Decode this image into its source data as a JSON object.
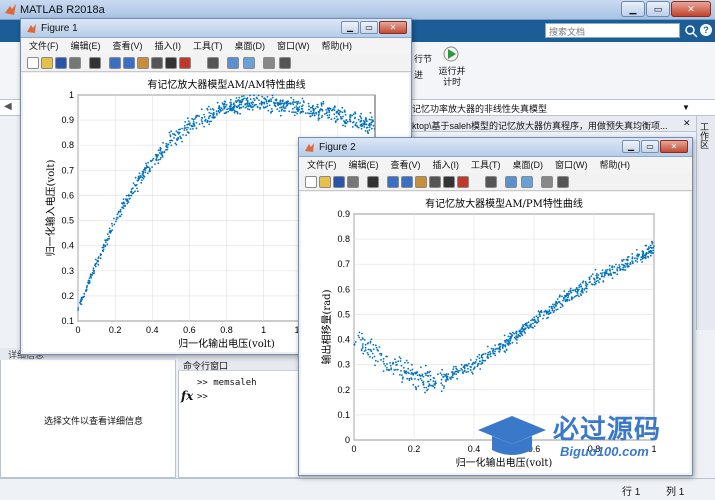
{
  "matlab": {
    "title": "MATLAB R2018a",
    "search_placeholder": "搜索文档",
    "help": "?",
    "ribbon_text1": "行节",
    "ribbon_text2": "进",
    "run_advance_label": "运行并计时",
    "path_text": "记忆功率放大器的非线性失真模型",
    "doc_text": "ktop\\基于saleh模型的记忆放大器仿真程序，用做预失真均衡项...",
    "workspace_label": "工作区",
    "details_title": "详细信息",
    "details_message": "选择文件以查看详细信息",
    "command_window_title": "命令行窗口",
    "command_history": ">> memsaleh",
    "command_prompt": ">>",
    "fx": "fx",
    "status_row": "行 1",
    "status_col": "列 1"
  },
  "menus": [
    "文件(F)",
    "编辑(E)",
    "查看(V)",
    "插入(I)",
    "工具(T)",
    "桌面(D)",
    "窗口(W)",
    "帮助(H)"
  ],
  "figure1": {
    "name": "Figure 1",
    "chart_title": "有记忆放大器模型AM/AM特性曲线",
    "xlabel": "归一化输出电压(volt)",
    "ylabel": "归一化输入电压(volt)"
  },
  "figure2": {
    "name": "Figure 2",
    "chart_title": "有记忆放大器模型AM/PM特性曲线",
    "xlabel": "归一化输出电压(volt)",
    "ylabel": "输出相移量(rad)"
  },
  "watermark": {
    "main": "必过源码",
    "url": "Biguo100.com"
  },
  "chart_data": [
    {
      "type": "scatter",
      "title": "有记忆放大器模型AM/AM特性曲线",
      "xlabel": "归一化输出电压(volt)",
      "ylabel": "归一化输入电压(volt)",
      "xlim": [
        0,
        1.6
      ],
      "ylim": [
        0.1,
        1.0
      ],
      "xticks": [
        "0",
        "0.2",
        "0.4",
        "0.6",
        "0.8",
        "1",
        "1.2",
        "1.4"
      ],
      "yticks": [
        "0.1",
        "0.2",
        "0.3",
        "0.4",
        "0.5",
        "0.6",
        "0.7",
        "0.8",
        "0.9",
        "1"
      ],
      "grid": true,
      "color": "#0072bd",
      "trend": {
        "x": [
          0.0,
          0.1,
          0.2,
          0.3,
          0.4,
          0.5,
          0.6,
          0.7,
          0.8,
          0.9,
          1.0,
          1.1,
          1.2,
          1.3,
          1.4,
          1.5,
          1.6
        ],
        "y": [
          0.15,
          0.33,
          0.5,
          0.63,
          0.73,
          0.82,
          0.88,
          0.92,
          0.95,
          0.965,
          0.97,
          0.96,
          0.95,
          0.94,
          0.92,
          0.9,
          0.88
        ]
      }
    },
    {
      "type": "scatter",
      "title": "有记忆放大器模型AM/PM特性曲线",
      "xlabel": "归一化输出电压(volt)",
      "ylabel": "输出相移量(rad)",
      "xlim": [
        0,
        1
      ],
      "ylim": [
        0,
        0.9
      ],
      "xticks": [
        "0",
        "0.2",
        "0.4",
        "0.6",
        "0.8",
        "1"
      ],
      "yticks": [
        "0",
        "0.1",
        "0.2",
        "0.3",
        "0.4",
        "0.5",
        "0.6",
        "0.7",
        "0.8",
        "0.9"
      ],
      "grid": true,
      "color": "#0072bd",
      "trend": {
        "x": [
          0.0,
          0.05,
          0.1,
          0.15,
          0.2,
          0.25,
          0.3,
          0.4,
          0.5,
          0.6,
          0.7,
          0.8,
          0.9,
          1.0
        ],
        "y": [
          0.4,
          0.36,
          0.32,
          0.28,
          0.25,
          0.24,
          0.25,
          0.3,
          0.38,
          0.47,
          0.56,
          0.64,
          0.7,
          0.76
        ]
      }
    }
  ]
}
